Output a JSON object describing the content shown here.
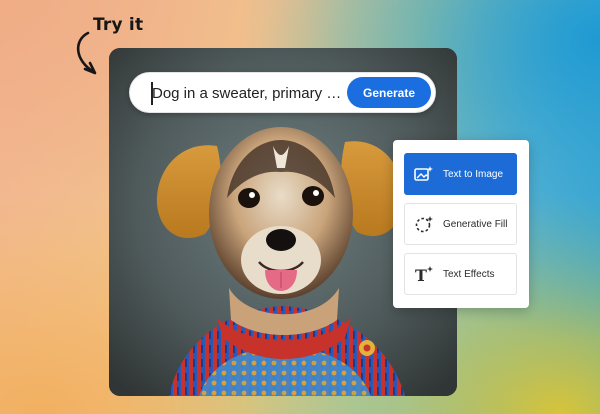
{
  "callout": {
    "text": "Try it"
  },
  "prompt": {
    "value": "Dog in a sweater, primary colo...",
    "button_label": "Generate"
  },
  "features": [
    {
      "label": "Text to Image",
      "icon": "image-sparkle-icon",
      "active": true
    },
    {
      "label": "Generative Fill",
      "icon": "dashed-circle-sparkle-icon",
      "active": false
    },
    {
      "label": "Text Effects",
      "icon": "text-effect-icon",
      "active": false
    }
  ],
  "colors": {
    "accent": "#1a6ee0",
    "active_item": "#1c6bd6"
  }
}
